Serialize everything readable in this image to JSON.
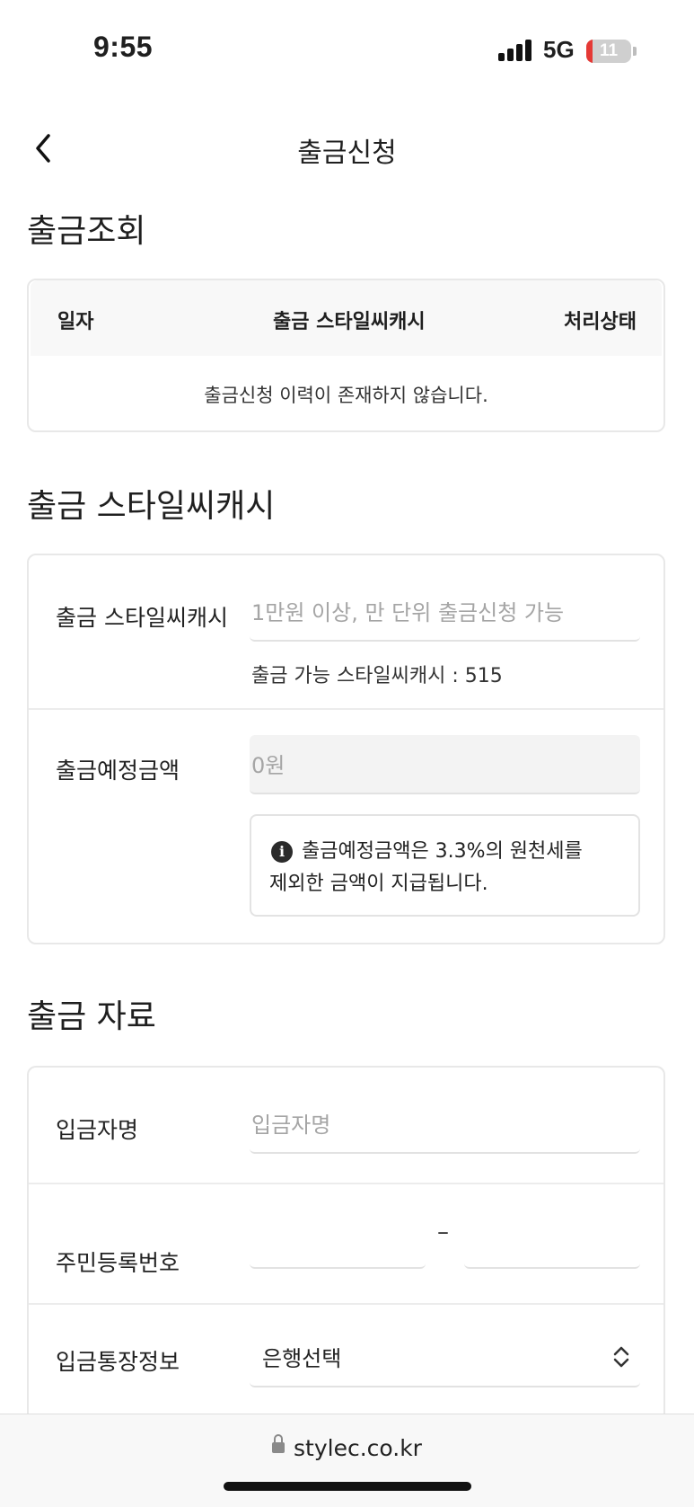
{
  "status_bar": {
    "time": "9:55",
    "network": "5G",
    "battery": "11"
  },
  "header": {
    "title": "출금신청"
  },
  "history": {
    "section_title": "출금조회",
    "columns": [
      "일자",
      "출금 스타일씨캐시",
      "처리상태"
    ],
    "empty_message": "출금신청 이력이 존재하지 않습니다."
  },
  "cash": {
    "section_title": "출금 스타일씨캐시",
    "amount_label": "출금 스타일씨캐시",
    "amount_placeholder": "1만원 이상, 만 단위 출금신청 가능",
    "available_text": "출금 가능 스타일씨캐시 : 515",
    "expected_label": "출금예정금액",
    "expected_value": "0원",
    "notice_icon": "info-icon",
    "notice_text": "출금예정금액은 3.3%의 원천세를 제외한 금액이 지급됩니다."
  },
  "account": {
    "section_title": "출금 자료",
    "depositor_label": "입금자명",
    "depositor_placeholder": "입금자명",
    "rrn_label": "주민등록번호",
    "rrn_separator": "–",
    "bank_label": "입금통장정보",
    "bank_select": "은행선택"
  },
  "browser": {
    "url": "stylec.co.kr"
  }
}
